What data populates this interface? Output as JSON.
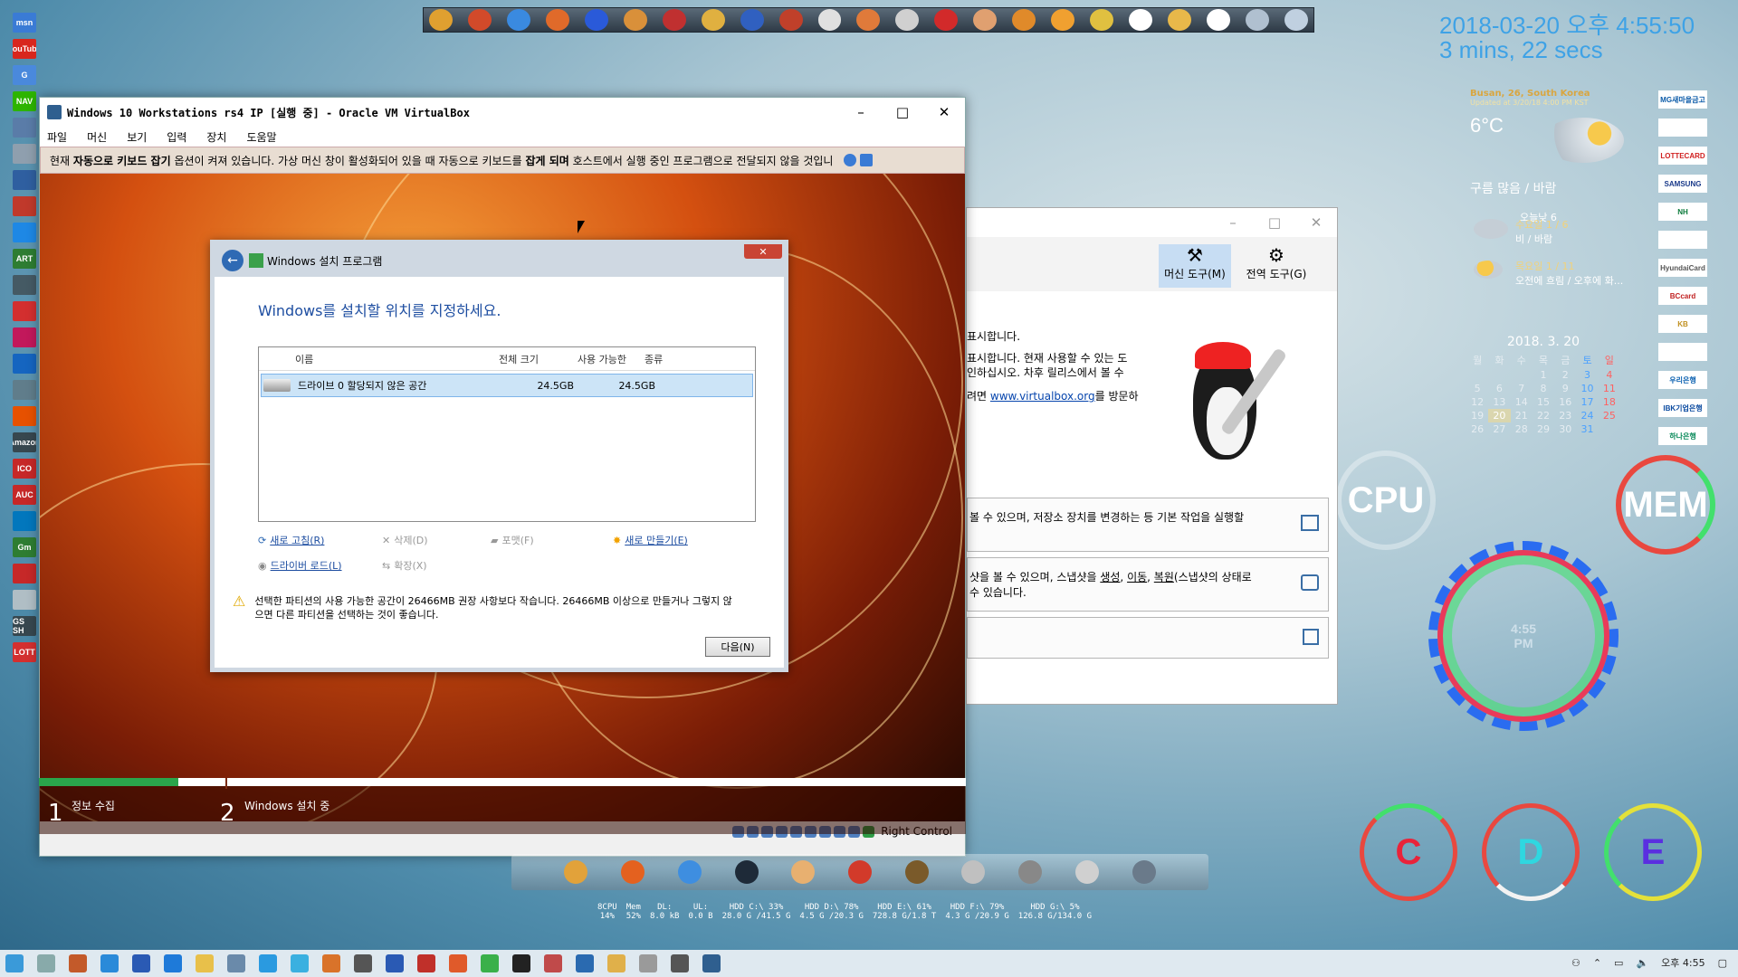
{
  "desktop": {
    "left_icons": [
      {
        "label": "msn",
        "icon": "msn-icon",
        "color": "#3a7bd5"
      },
      {
        "label": "YouTube",
        "icon": "youtube-icon",
        "color": "#d8261d"
      },
      {
        "label": "G",
        "icon": "google-icon",
        "color": "#4a89dc"
      },
      {
        "label": "NAV",
        "icon": "naver-icon",
        "color": "#2db400"
      },
      {
        "label": "",
        "icon": "app-icon",
        "color": "#5a7ca8"
      },
      {
        "label": "",
        "icon": "app-icon",
        "color": "#8f9fae"
      },
      {
        "label": "",
        "icon": "app-icon",
        "color": "#2f5fa0"
      },
      {
        "label": "",
        "icon": "app-icon",
        "color": "#c0392b"
      },
      {
        "label": "",
        "icon": "app-icon",
        "color": "#1e88e5"
      },
      {
        "label": "ART",
        "icon": "art-icon",
        "color": "#2e7d32"
      },
      {
        "label": "",
        "icon": "app-icon",
        "color": "#455a64"
      },
      {
        "label": "",
        "icon": "app-icon",
        "color": "#d32f2f"
      },
      {
        "label": "",
        "icon": "app-icon",
        "color": "#c2185b"
      },
      {
        "label": "",
        "icon": "app-icon",
        "color": "#1565c0"
      },
      {
        "label": "",
        "icon": "app-icon",
        "color": "#607d8b"
      },
      {
        "label": "",
        "icon": "app-icon",
        "color": "#e65100"
      },
      {
        "label": "Amazon",
        "icon": "amazon-icon",
        "color": "#37474f"
      },
      {
        "label": "ICO",
        "icon": "ico-icon",
        "color": "#c62828"
      },
      {
        "label": "AUC",
        "icon": "auction-icon",
        "color": "#c62828"
      },
      {
        "label": "",
        "icon": "app-icon",
        "color": "#0277bd"
      },
      {
        "label": "Gm",
        "icon": "gmarket-icon",
        "color": "#2e7d32"
      },
      {
        "label": "",
        "icon": "app-icon",
        "color": "#c62828"
      },
      {
        "label": "",
        "icon": "app-icon",
        "color": "#b0bec5"
      },
      {
        "label": "GS SH",
        "icon": "gsshop-icon",
        "color": "#37474f"
      },
      {
        "label": "LOTT",
        "icon": "lotte-icon",
        "color": "#d32f2f"
      }
    ],
    "top_launcher_icons": [
      "app-1-icon",
      "app-2-icon",
      "app-3-icon",
      "app-4-icon",
      "app-5-icon",
      "app-6-icon",
      "app-7-icon",
      "app-8-icon",
      "app-9-icon",
      "app-10-icon",
      "app-11-icon",
      "app-12-icon",
      "app-13-icon",
      "app-14-icon",
      "app-15-icon",
      "app-16-icon",
      "app-17-icon",
      "app-18-icon",
      "app-19-icon",
      "pencil-icon",
      "tools-icon",
      "drop-icon",
      "settings-icon"
    ],
    "clock": {
      "date_time": "2018-03-20 오후 4:55:50",
      "elapsed": "3 mins, 22 secs"
    },
    "weather": {
      "location": "Busan, 26, South Korea",
      "updated": "Updated at 3/20/18 4:00 PM KST",
      "temp": "6°C",
      "condition": "구름 많음 / 바람",
      "today": "오늘낮 6",
      "forecast": [
        {
          "day": "수요일 1 / 6",
          "desc": "비 / 바람"
        },
        {
          "day": "목요일 1 / 11",
          "desc": "오전에 흐림 / 오후에 화..."
        }
      ]
    },
    "calendar": {
      "title": "2018. 3. 20",
      "weekdays": [
        "월",
        "화",
        "수",
        "목",
        "금",
        "토",
        "일"
      ],
      "weeks": [
        [
          "",
          "",
          "",
          "1",
          "2",
          "3",
          "4"
        ],
        [
          "5",
          "6",
          "7",
          "8",
          "9",
          "10",
          "11"
        ],
        [
          "12",
          "13",
          "14",
          "15",
          "16",
          "17",
          "18"
        ],
        [
          "19",
          "20",
          "21",
          "22",
          "23",
          "24",
          "25"
        ],
        [
          "26",
          "27",
          "28",
          "29",
          "30",
          "31",
          ""
        ]
      ]
    },
    "banks": [
      "MG새마을금고",
      "",
      "LOTTECARD",
      "SAMSUNG",
      "NH",
      "",
      "HyundaiCard",
      "BCcard",
      "KB",
      "",
      "우리은행",
      "IBK기업은행",
      "하나은행"
    ],
    "gauges": {
      "cpu": "CPU",
      "mem": "MEM",
      "drive_c": "C",
      "drive_d": "D",
      "drive_e": "E",
      "clock_center": "4:55",
      "clock_ampm": "PM"
    }
  },
  "vbox": {
    "title": "Windows 10 Workstations rs4 IP [실행 중] - Oracle VM VirtualBox",
    "menu": [
      "파일",
      "머신",
      "보기",
      "입력",
      "장치",
      "도움말"
    ],
    "notice_pre": "현재 ",
    "notice_b1": "자동으로 키보드 잡기",
    "notice_mid": " 옵션이 켜져 있습니다. 가상 머신 창이 활성화되어 있을 때 자동으로 키보드를 ",
    "notice_b2": "잡게 되며",
    "notice_post": " 호스트에서 실행 중인 프로그램으로 전달되지 않을 것입니",
    "status_text": "Right Control"
  },
  "setup": {
    "title": "Windows 설치 프로그램",
    "heading": "Windows를 설치할 위치를 지정하세요.",
    "columns": [
      "이름",
      "전체 크기",
      "사용 가능한",
      "종류"
    ],
    "rows": [
      {
        "name": "드라이브 0 할당되지 않은 공간",
        "total": "24.5GB",
        "free": "24.5GB",
        "type": ""
      }
    ],
    "tools": {
      "refresh": "새로 고침(R)",
      "delete": "삭제(D)",
      "format": "포맷(F)",
      "new": "새로 만들기(E)",
      "load_driver": "드라이버 로드(L)",
      "extend": "확장(X)"
    },
    "warning": "선택한 파티션의 사용 가능한 공간이 26466MB 권장 사항보다 작습니다. 26466MB 이상으로 만들거나 그렇지 않으면 다른 파티션을 선택하는 것이 좋습니다.",
    "next": "다음(N)"
  },
  "progress": {
    "step1_num": "1",
    "step1": "정보 수집",
    "step2_num": "2",
    "step2": "Windows 설치 중",
    "fill": 0.15
  },
  "manager": {
    "tool_machine": "머신 도구(M)",
    "tool_global": "전역 도구(G)",
    "welcome_1": "표시합니다.",
    "welcome_2": "표시합니다. 현재 사용할 수 있는 도",
    "welcome_3": "인하십시오. 차후 릴리스에서 볼 수",
    "welcome_4_pre": "려면 ",
    "welcome_link": "www.virtualbox.org",
    "welcome_4_post": "를 방문하",
    "section1": "볼 수 있으며, 저장소 장치를 변경하는 등 기본 작업을 실행할",
    "section2_a": "샷을 볼 수 있으며, 스냅샷을 ",
    "section2_l1": "생성",
    "section2_c1": ", ",
    "section2_l2": "이동",
    "section2_c2": ", ",
    "section2_l3": "복원",
    "section2_b": "(스냅샷의 상태로",
    "section2_c": "수 있습니다."
  },
  "meters": [
    {
      "k": "8CPU",
      "v": "14%"
    },
    {
      "k": "Mem",
      "v": "52%"
    },
    {
      "k": "DL:",
      "v": "8.0 kB"
    },
    {
      "k": "UL:",
      "v": "0.0 B"
    },
    {
      "k": "HDD C:\\  33%",
      "v": "28.0 G /41.5 G"
    },
    {
      "k": "HDD D:\\  78%",
      "v": "4.5 G /20.3 G"
    },
    {
      "k": "HDD E:\\  61%",
      "v": "728.8 G/1.8 T"
    },
    {
      "k": "HDD F:\\  79%",
      "v": "4.3 G /20.9 G"
    },
    {
      "k": "HDD G:\\  5%",
      "v": "126.8 G/134.0 G"
    }
  ],
  "taskbar": {
    "time": "오후 4:55"
  }
}
